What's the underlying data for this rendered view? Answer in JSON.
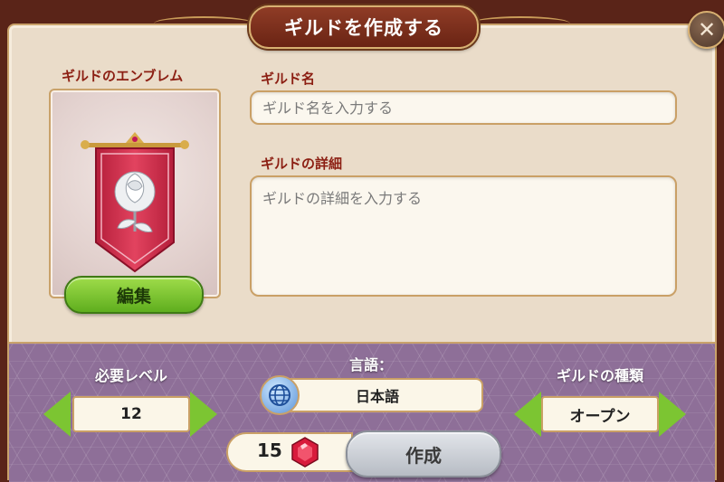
{
  "dialog": {
    "title": "ギルドを作成する",
    "close_icon": "close-icon"
  },
  "emblem": {
    "label": "ギルドのエンブレム",
    "edit_label": "編集",
    "icon": "rose-banner-icon"
  },
  "guild_name": {
    "label": "ギルド名",
    "placeholder": "ギルド名を入力する",
    "value": ""
  },
  "guild_detail": {
    "label": "ギルドの詳細",
    "placeholder": "ギルドの詳細を入力する",
    "value": ""
  },
  "required_level": {
    "label": "必要レベル",
    "value": "12"
  },
  "language": {
    "label": "言語：",
    "value": "日本語",
    "icon": "globe-icon"
  },
  "guild_type": {
    "label": "ギルドの種類",
    "value": "オープン"
  },
  "create": {
    "cost": "15",
    "cost_icon": "ruby-gem-icon",
    "label": "作成"
  },
  "colors": {
    "title_plate": "#7b2d1a",
    "panel": "#eadcc9",
    "label_red": "#8c1f13",
    "band_purple": "#8e6f98",
    "arrow_green": "#7cc532",
    "edit_green": "#6cbf26",
    "banner_red": "#d6324f"
  }
}
